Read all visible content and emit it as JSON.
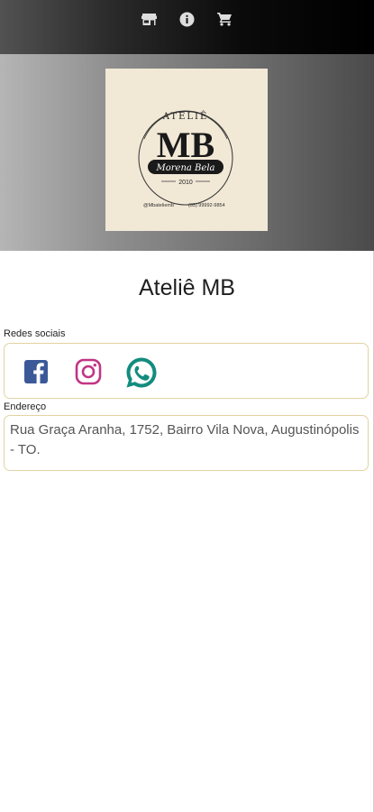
{
  "header": {
    "icons": [
      "store-icon",
      "info-icon",
      "cart-icon"
    ]
  },
  "logo": {
    "top_text": "ATELIÊ",
    "monogram": "MB",
    "script_text": "Morena Bela",
    "year": "2010",
    "footer_left": "@Mbateliemb",
    "footer_right": "(33) 99992-9854"
  },
  "store": {
    "title": "Ateliê MB"
  },
  "social": {
    "label": "Redes sociais",
    "colors": {
      "facebook": "#3b5998",
      "instagram": "#c13584",
      "whatsapp": "#128c7e"
    }
  },
  "address": {
    "label": "Endereço",
    "text": "Rua Graça Aranha, 1752, Bairro Vila Nova, Augustinópolis - TO."
  }
}
